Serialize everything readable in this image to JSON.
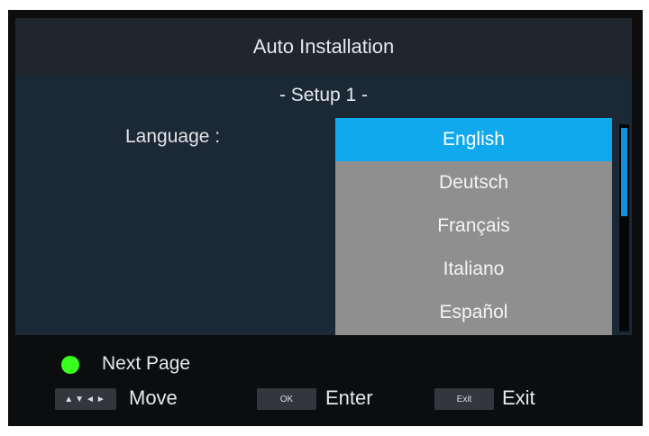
{
  "header": {
    "title": "Auto Installation"
  },
  "main": {
    "subtitle": "- Setup 1 -",
    "language_label": "Language :",
    "language_options": [
      "English",
      "Deutsch",
      "Français",
      "Italiano",
      "Español"
    ],
    "selected_language": "English"
  },
  "footer": {
    "next_page_label": "Next Page",
    "next_page_color": "#39ff1e",
    "move_key_glyphs": "▲▼◄►",
    "move_label": "Move",
    "ok_key_label": "OK",
    "enter_label": "Enter",
    "exit_key_label": "Exit",
    "exit_label": "Exit"
  },
  "colors": {
    "selection_highlight": "#11a9ee",
    "list_background": "#8f8f8f",
    "scroll_thumb": "#1190dd"
  }
}
